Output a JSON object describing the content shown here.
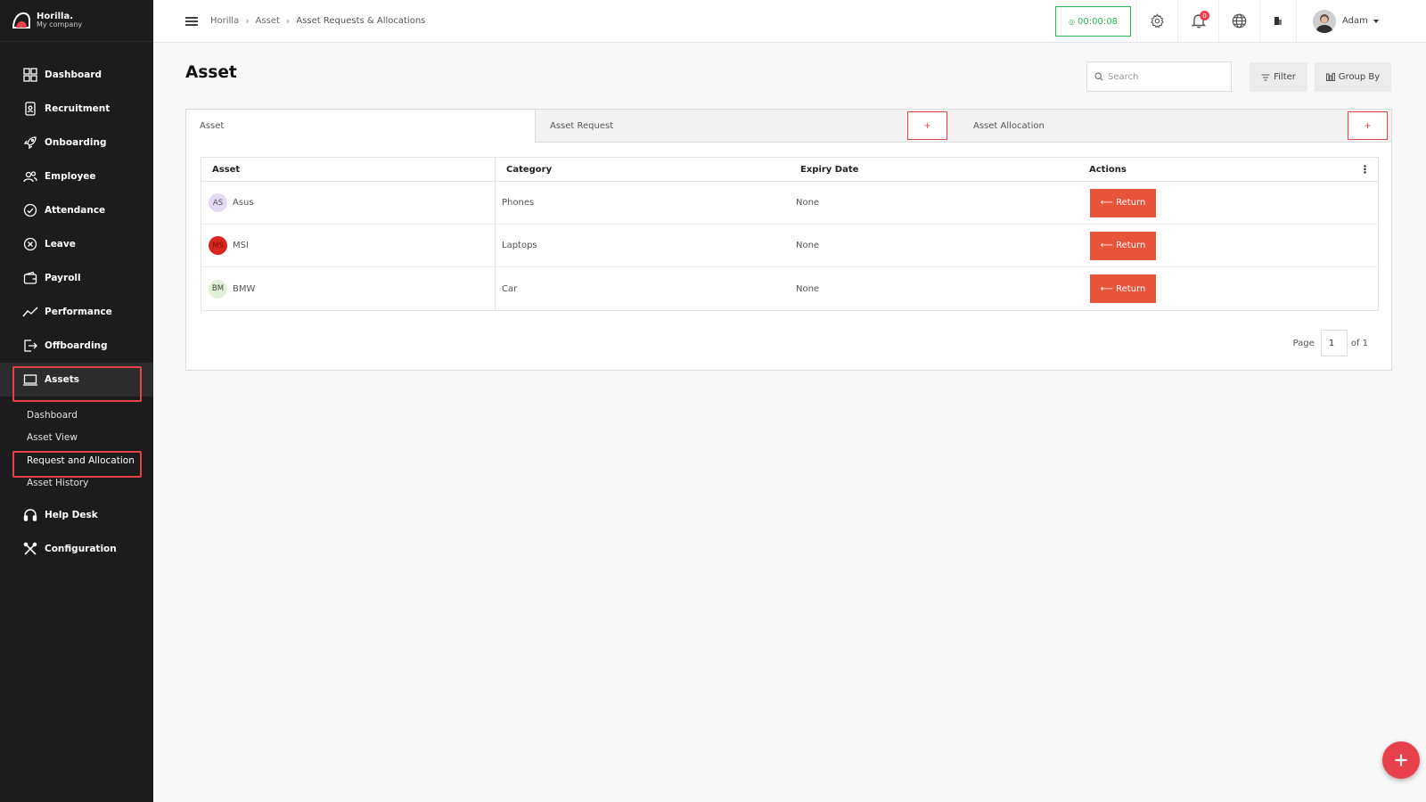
{
  "brand": {
    "name": "Horilla.",
    "company": "My company"
  },
  "sidebar": {
    "items": [
      {
        "label": "Dashboard",
        "icon": "dashboard-icon"
      },
      {
        "label": "Recruitment",
        "icon": "recruitment-icon"
      },
      {
        "label": "Onboarding",
        "icon": "rocket-icon"
      },
      {
        "label": "Employee",
        "icon": "users-icon"
      },
      {
        "label": "Attendance",
        "icon": "check-circle-icon"
      },
      {
        "label": "Leave",
        "icon": "x-circle-icon"
      },
      {
        "label": "Payroll",
        "icon": "wallet-icon"
      },
      {
        "label": "Performance",
        "icon": "trend-icon"
      },
      {
        "label": "Offboarding",
        "icon": "exit-icon"
      },
      {
        "label": "Assets",
        "icon": "laptop-icon"
      }
    ],
    "sub_items": [
      "Dashboard",
      "Asset View",
      "Request and Allocation",
      "Asset History"
    ],
    "bottom_items": [
      {
        "label": "Help Desk",
        "icon": "headset-icon"
      },
      {
        "label": "Configuration",
        "icon": "tools-icon"
      }
    ]
  },
  "topbar": {
    "breadcrumbs": [
      "Horilla",
      "Asset",
      "Asset Requests & Allocations"
    ],
    "timer": "00:00:08",
    "notification_count": "0",
    "user_name": "Adam"
  },
  "main": {
    "title": "Asset",
    "search_placeholder": "Search",
    "filter_label": "Filter",
    "group_by_label": "Group By",
    "tabs": [
      {
        "label": "Asset"
      },
      {
        "label": "Asset Request",
        "add": "+"
      },
      {
        "label": "Asset Allocation",
        "add": "+"
      }
    ],
    "table": {
      "headers": [
        "Asset",
        "Category",
        "Expiry Date",
        "Actions"
      ],
      "rows": [
        {
          "initials": "AS",
          "asset": "Asus",
          "category": "Phones",
          "expiry": "None",
          "action": "⟵ Return",
          "avatar_bg": "#e3d9f2",
          "avatar_fg": "#555555"
        },
        {
          "initials": "MS",
          "asset": "MSI",
          "category": "Laptops",
          "expiry": "None",
          "action": "⟵ Return",
          "avatar_bg": "#d8261c",
          "avatar_fg": "#7a0f0a"
        },
        {
          "initials": "BM",
          "asset": "BMW",
          "category": "Car",
          "expiry": "None",
          "action": "⟵ Return",
          "avatar_bg": "#e3f0d8",
          "avatar_fg": "#444444"
        }
      ]
    },
    "pagination": {
      "page_label": "Page",
      "current": "1",
      "of_label": "of 1"
    }
  },
  "colors": {
    "accent": "#e8414b",
    "return_button": "#e8543a",
    "timer": "#2fb556",
    "sidebar_bg": "#1c1c1c"
  }
}
